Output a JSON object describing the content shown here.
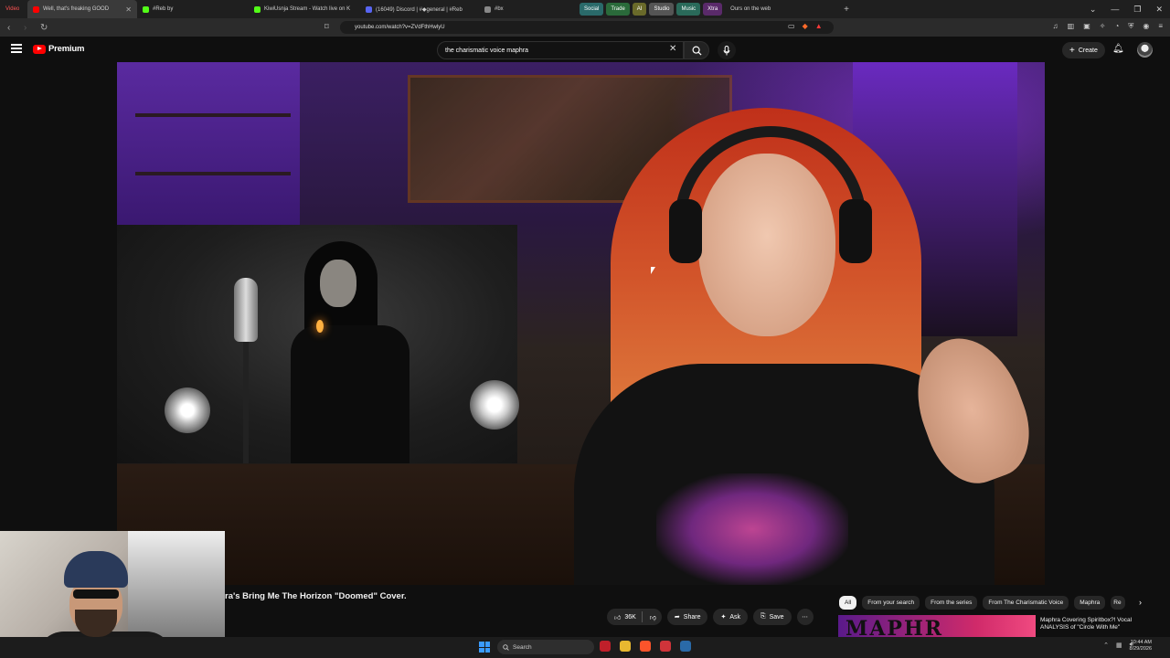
{
  "browser": {
    "tabs": [
      {
        "label": "Video",
        "color": "#ff5252"
      },
      {
        "label": "Well, that's freaking GOOD",
        "color": "#ff0000",
        "active": true
      },
      {
        "label": "#Reb by",
        "color": "#53fc18"
      },
      {
        "label": "KiwiUsnja Stream - Watch live on K",
        "color": "#53fc18"
      },
      {
        "label": "(16049) Discord | #◆general | #Reb",
        "color": "#5865f2"
      },
      {
        "label": "#bx",
        "color": "#888888"
      }
    ],
    "tab_groups": [
      {
        "label": "Social",
        "color": "#2a6a6a"
      },
      {
        "label": "Trade",
        "color": "#2a6a3a"
      },
      {
        "label": "AI",
        "color": "#6a6a2a"
      },
      {
        "label": "Studio",
        "color": "#555555"
      },
      {
        "label": "Music",
        "color": "#2a6a5a"
      },
      {
        "label": "Xtra",
        "color": "#5a2a6a"
      }
    ],
    "extra_tab": "Ours on the web",
    "url": "youtube.com/watch?v=ZVdFthHwlyU"
  },
  "youtube": {
    "logo_label": "Premium",
    "search_value": "the charismatic voice maphra",
    "create_label": "Create",
    "video_title": "ra's Bring Me The Horizon \"Doomed\" Cover.",
    "actions": {
      "likes": "36K",
      "share": "Share",
      "ask": "Ask",
      "save": "Save"
    },
    "chips": [
      "All",
      "From your search",
      "From the series",
      "From The Charismatic Voice",
      "Maphra",
      "Re"
    ],
    "recommendation": {
      "thumb_text": "MAPHR",
      "title": "Maphra Covering Spiritbox?! Vocal ANALYSIS of \"Circle With Me\""
    }
  },
  "taskbar": {
    "search_label": "Search",
    "time": "10:44 AM",
    "date": "8/29/2026"
  },
  "colors": {
    "yt_red": "#ff0000",
    "background": "#0f0f0f",
    "pill": "#272727"
  }
}
